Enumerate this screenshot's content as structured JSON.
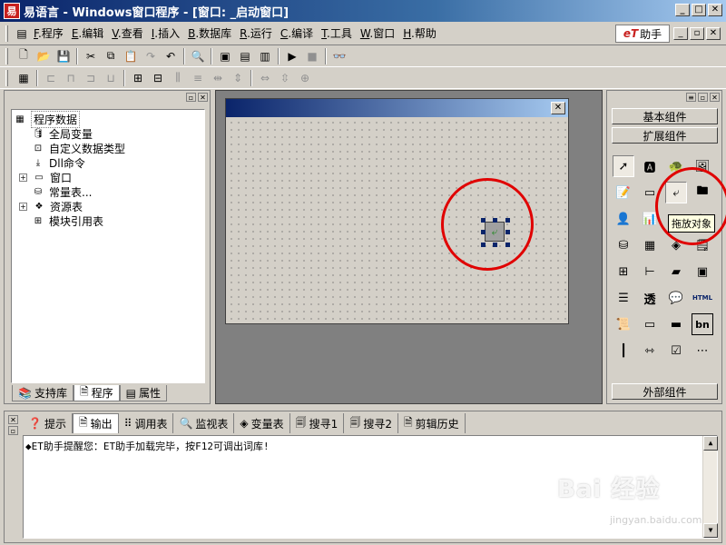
{
  "window": {
    "title": "易语言 - Windows窗口程序 - [窗口: _启动窗口]",
    "app_icon": "easy-language-logo-icon"
  },
  "menu": [
    {
      "key": "F",
      "label": ".程序"
    },
    {
      "key": "E",
      "label": ".编辑"
    },
    {
      "key": "V",
      "label": ".查看"
    },
    {
      "key": "I",
      "label": ".插入"
    },
    {
      "key": "B",
      "label": ".数据库"
    },
    {
      "key": "R",
      "label": ".运行"
    },
    {
      "key": "C",
      "label": ".编译"
    },
    {
      "key": "T",
      "label": ".工具"
    },
    {
      "key": "W",
      "label": ".窗口"
    },
    {
      "key": "H",
      "label": ".帮助"
    }
  ],
  "et_button": {
    "logo": "eT",
    "label": "助手"
  },
  "tree": {
    "root": "程序数据",
    "items": [
      {
        "label": "全局变量",
        "icon": "database-icon",
        "expandable": false
      },
      {
        "label": "自定义数据类型",
        "icon": "type-icon",
        "expandable": false
      },
      {
        "label": "Dll命令",
        "icon": "dll-icon",
        "expandable": false
      },
      {
        "label": "窗口",
        "icon": "window-icon",
        "expandable": true
      },
      {
        "label": "常量表...",
        "icon": "constants-icon",
        "expandable": false
      },
      {
        "label": "资源表",
        "icon": "resource-icon",
        "expandable": true
      },
      {
        "label": "模块引用表",
        "icon": "module-icon",
        "expandable": false
      }
    ]
  },
  "left_tabs": [
    "支持库",
    "程序",
    "属性"
  ],
  "palette": {
    "basic": "基本组件",
    "extended": "扩展组件",
    "external": "外部组件",
    "tooltip": "拖放对象",
    "text_icons": {
      "tou": "透",
      "bn": "bn",
      "html": "HTML"
    }
  },
  "bottom_tabs": [
    "提示",
    "输出",
    "调用表",
    "监视表",
    "变量表",
    "搜寻1",
    "搜寻2",
    "剪辑历史"
  ],
  "output": {
    "text": "◆ET助手提醒您：ET助手加载完毕，按F12可调出词库!"
  },
  "watermark": {
    "main": "Bai 经验",
    "sub": "jingyan.baidu.com"
  },
  "colors": {
    "titlebar_start": "#0a246a",
    "titlebar_end": "#a6caf0",
    "highlight_circle": "#e00000",
    "tooltip_bg": "#ffffe1"
  }
}
